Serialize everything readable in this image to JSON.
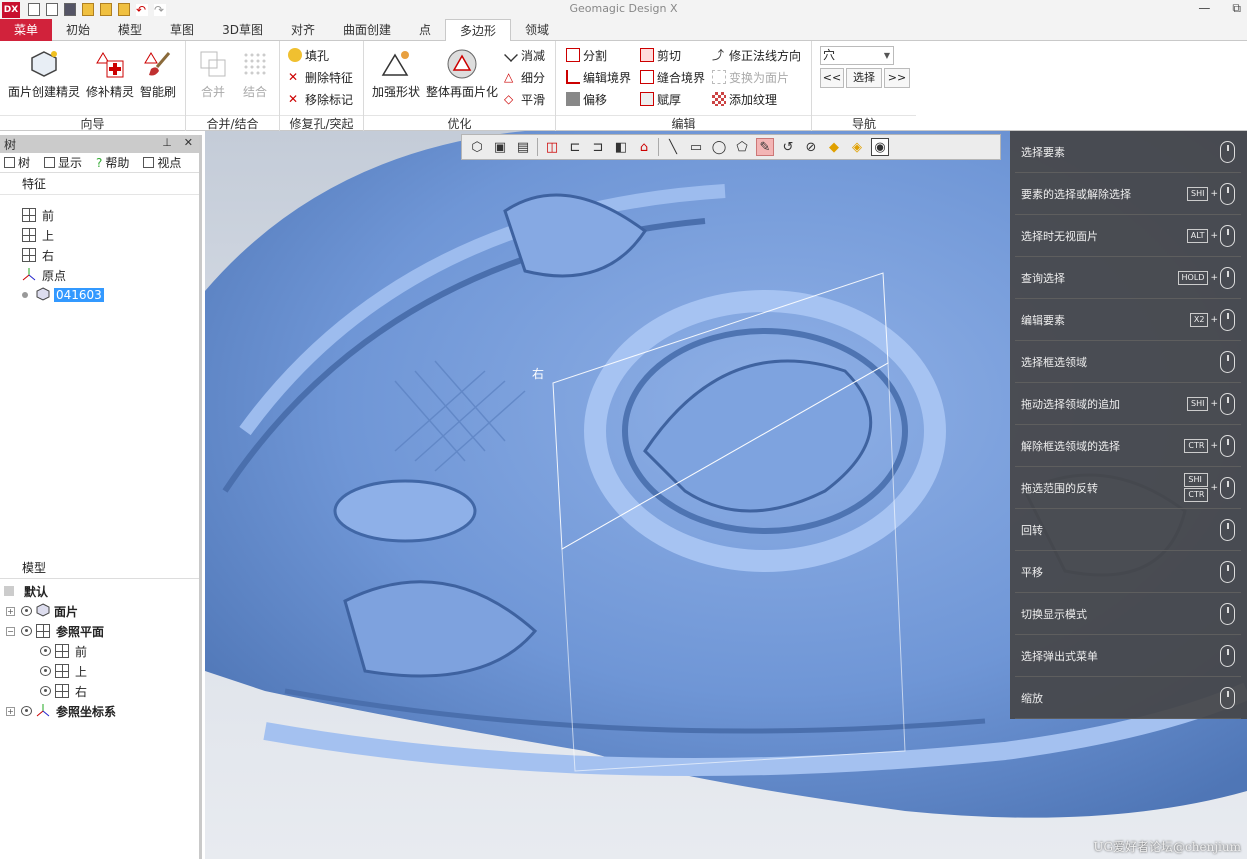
{
  "window": {
    "logo": "DX",
    "title": "Geomagic Design X",
    "minimize": "—",
    "restore": "⧉"
  },
  "tabs": [
    {
      "label": "菜单",
      "kind": "menu"
    },
    {
      "label": "初始"
    },
    {
      "label": "模型"
    },
    {
      "label": "草图"
    },
    {
      "label": "3D草图"
    },
    {
      "label": "对齐"
    },
    {
      "label": "曲面创建"
    },
    {
      "label": "点"
    },
    {
      "label": "多边形",
      "active": true
    },
    {
      "label": "领域"
    }
  ],
  "ribbon": {
    "wizard": {
      "title": "向导",
      "buttons": [
        "面片创建精灵",
        "修补精灵",
        "智能刷"
      ]
    },
    "merge": {
      "title": "合并/结合",
      "buttons": [
        "合并",
        "结合"
      ]
    },
    "repair": {
      "title": "修复孔/突起",
      "buttons": [
        "填孔",
        "删除特征",
        "移除标记"
      ]
    },
    "optimize": {
      "title": "优化",
      "buttons": [
        "加强形状",
        "整体再面片化"
      ],
      "small": [
        "消减",
        "细分",
        "平滑"
      ]
    },
    "edit": {
      "title": "编辑",
      "col1": [
        "分割",
        "编辑境界",
        "偏移"
      ],
      "col2": [
        "剪切",
        "缝合境界",
        "赋厚"
      ],
      "col3": [
        "修正法线方向",
        "变换为面片",
        "添加纹理"
      ]
    },
    "nav": {
      "title": "导航",
      "select_value": "穴",
      "prev": "<<",
      "select": "选择",
      "next": ">>"
    }
  },
  "tree": {
    "title": "树",
    "subtabs": [
      "树",
      "显示",
      "帮助",
      "视点"
    ],
    "features_header": "特征",
    "features": [
      "前",
      "上",
      "右",
      "原点",
      "041603"
    ],
    "model_header": "模型",
    "model_items": [
      "默认",
      "面片",
      "参照平面",
      "前",
      "上",
      "右",
      "参照坐标系"
    ]
  },
  "viewport": {
    "plane_label": "右",
    "watermark": "UG爱好者论坛@chenjium"
  },
  "hints": [
    {
      "label": "选择要素",
      "keys": []
    },
    {
      "label": "要素的选择或解除选择",
      "keys": [
        "SHI"
      ]
    },
    {
      "label": "选择时无视面片",
      "keys": [
        "ALT"
      ]
    },
    {
      "label": "查询选择",
      "keys": [
        "HOLD"
      ]
    },
    {
      "label": "编辑要素",
      "keys": [
        "X2"
      ]
    },
    {
      "label": "选择框选领域",
      "keys": []
    },
    {
      "label": "拖动选择领域的追加",
      "keys": [
        "SHI"
      ]
    },
    {
      "label": "解除框选领域的选择",
      "keys": [
        "CTR"
      ]
    },
    {
      "label": "拖选范围的反转",
      "keys": [
        "SHI",
        "CTR"
      ]
    },
    {
      "label": "回转",
      "keys": []
    },
    {
      "label": "平移",
      "keys": []
    },
    {
      "label": "切换显示模式",
      "keys": []
    },
    {
      "label": "选择弹出式菜单",
      "keys": []
    },
    {
      "label": "缩放",
      "keys": []
    }
  ],
  "colors": {
    "menu": "#d1223b",
    "mesh": "#6f96d6",
    "panel": "#464648"
  }
}
